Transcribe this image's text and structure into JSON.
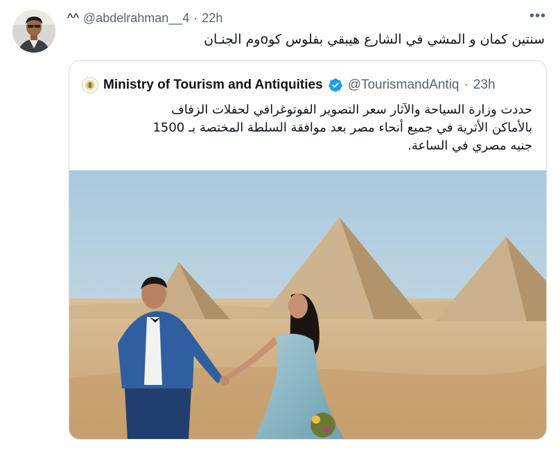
{
  "tweet": {
    "display_name": "^^",
    "handle": "@abdelrahman__4",
    "separator": "·",
    "time": "22h",
    "more_icon": "more-horizontal-icon",
    "text": "سنتين كمان و المشي في الشارع هيبقي بفلوس كوoوم الجنـان"
  },
  "quoted_tweet": {
    "display_name": "Ministry of Tourism and Antiquities",
    "verified": true,
    "verified_color": "#1d9bf0",
    "handle": "@TourismandAntiq",
    "separator": "·",
    "time": "23h",
    "text_lines": [
      "حددت وزارة السياحة والآثار سعر التصوير  الفوتوغرافي لحفلات الزفاف",
      "بالأماكن الأثرية في جميع أنحاء مصر بعد موافقة السلطة المختصة بـ 1500",
      "جنيه مصري في الساعة."
    ],
    "media": "photo of a wedding couple walking hand in hand before the Giza pyramids"
  },
  "colors": {
    "text_primary": "#0f1419",
    "text_secondary": "#536471",
    "border": "#cfd9de"
  }
}
